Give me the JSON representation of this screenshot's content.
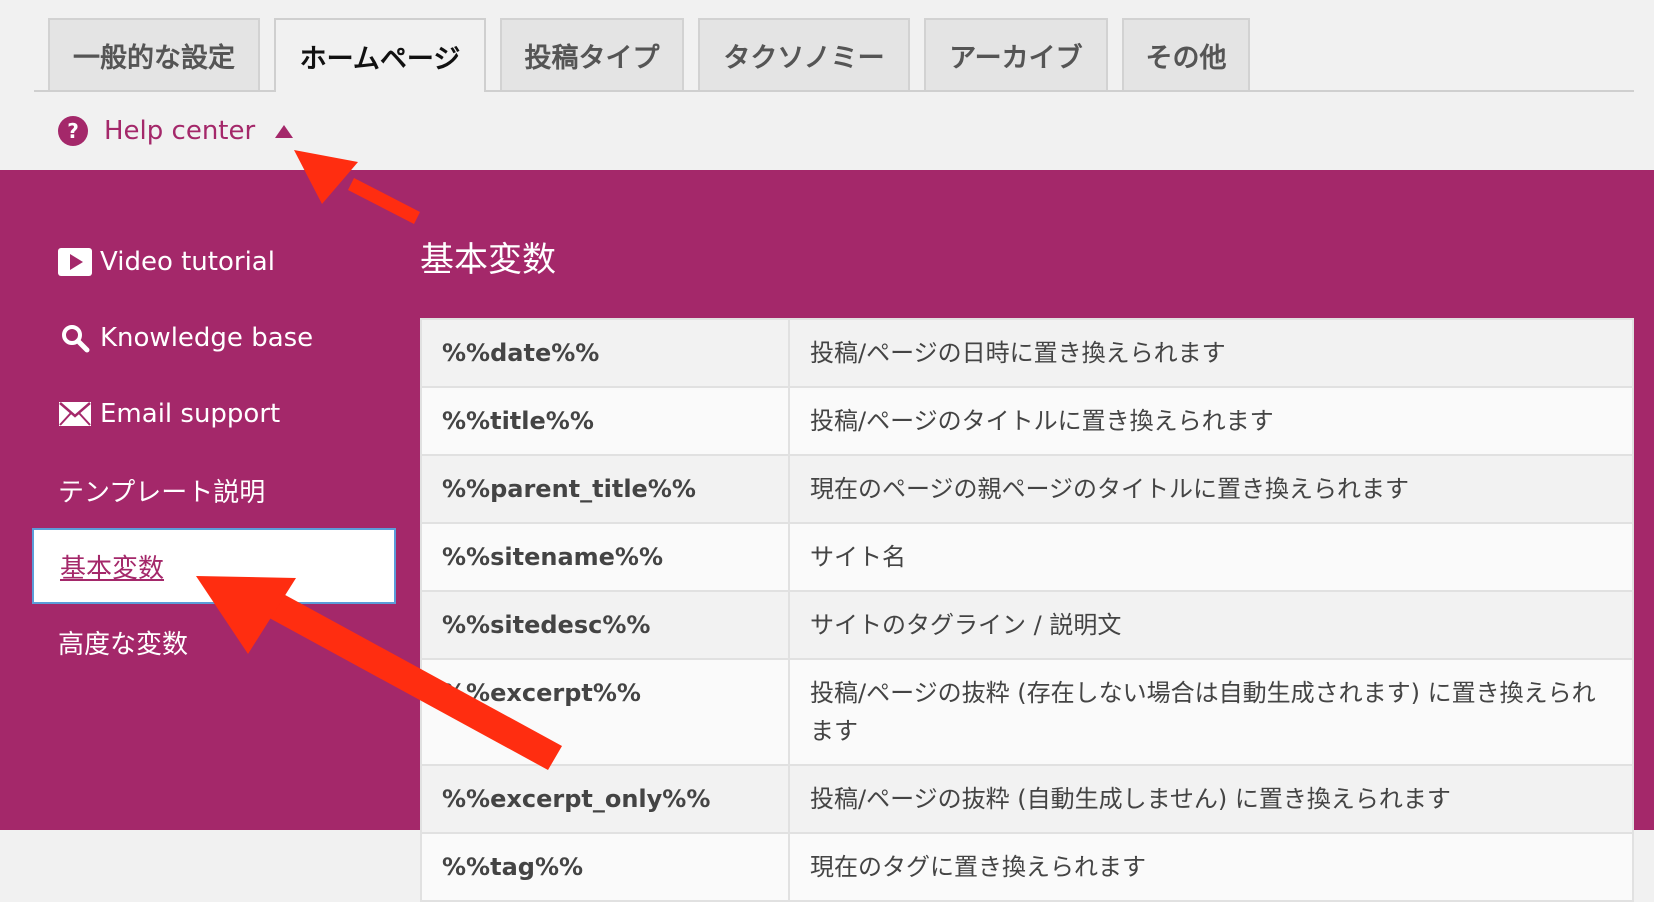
{
  "tabs": [
    {
      "label": "一般的な設定",
      "active": false
    },
    {
      "label": "ホームページ",
      "active": true
    },
    {
      "label": "投稿タイプ",
      "active": false
    },
    {
      "label": "タクソノミー",
      "active": false
    },
    {
      "label": "アーカイブ",
      "active": false
    },
    {
      "label": "その他",
      "active": false
    }
  ],
  "help_center": {
    "icon_glyph": "?",
    "label": "Help center",
    "expanded": true
  },
  "help_nav": {
    "items": [
      {
        "label": "Video tutorial",
        "icon": "play-icon"
      },
      {
        "label": "Knowledge base",
        "icon": "search-icon"
      },
      {
        "label": "Email support",
        "icon": "envelope-icon"
      },
      {
        "label": "テンプレート説明"
      },
      {
        "label": "基本変数",
        "active": true
      },
      {
        "label": "高度な変数"
      }
    ]
  },
  "content": {
    "title": "基本変数",
    "rows": [
      {
        "var": "%%date%%",
        "desc": "投稿/ページの日時に置き換えられます"
      },
      {
        "var": "%%title%%",
        "desc": "投稿/ページのタイトルに置き換えられます"
      },
      {
        "var": "%%parent_title%%",
        "desc": "現在のページの親ページのタイトルに置き換えられます"
      },
      {
        "var": "%%sitename%%",
        "desc": "サイト名"
      },
      {
        "var": "%%sitedesc%%",
        "desc": "サイトのタグライン / 説明文"
      },
      {
        "var": "%%excerpt%%",
        "desc": "投稿/ページの抜粋 (存在しない場合は自動生成されます) に置き換えられます"
      },
      {
        "var": "%%excerpt_only%%",
        "desc": "投稿/ページの抜粋 (自動生成しません) に置き換えられます"
      },
      {
        "var": "%%tag%%",
        "desc": "現在のタグに置き換えられます"
      }
    ]
  },
  "colors": {
    "brand": "#a4286a",
    "active_border": "#5b9dd9",
    "annotation_arrow": "#ff2d10"
  }
}
